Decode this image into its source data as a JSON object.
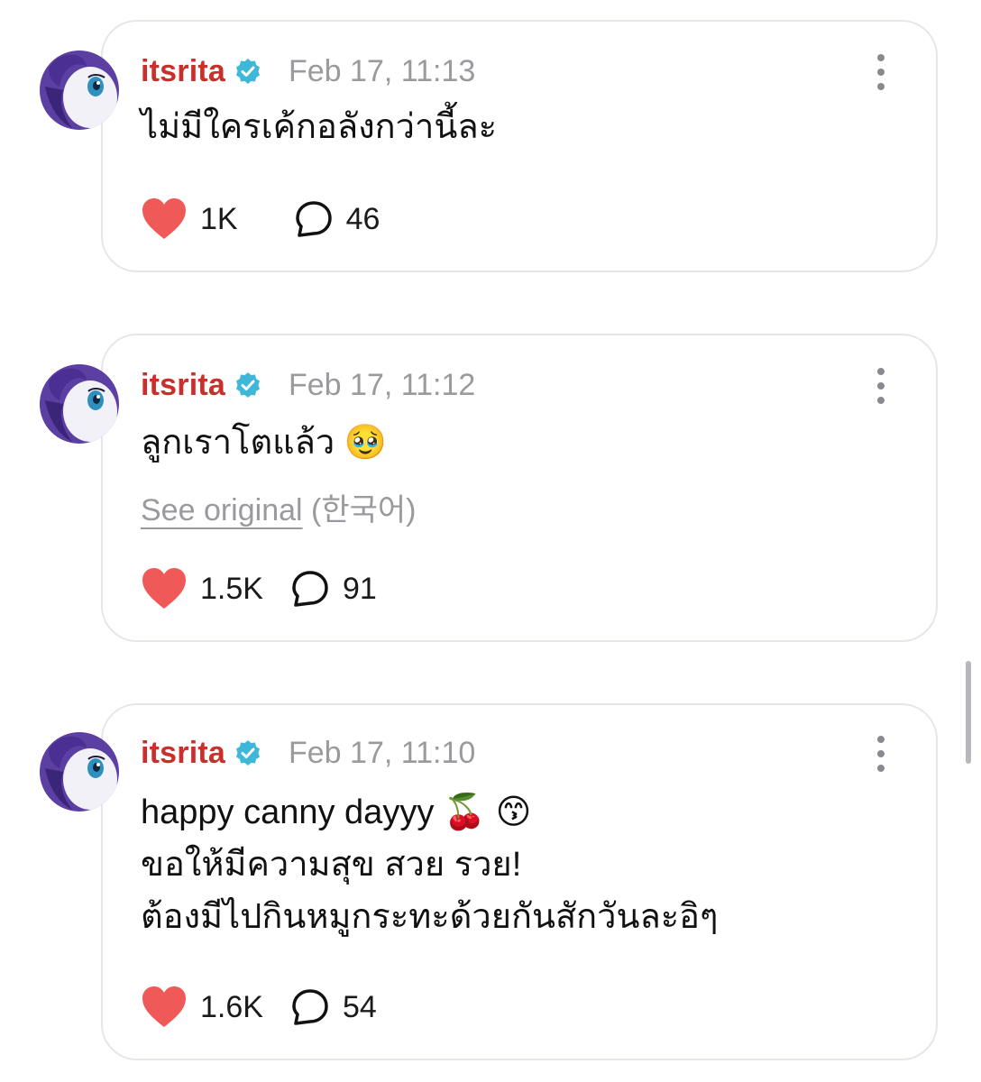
{
  "posts": [
    {
      "username": "itsrita",
      "timestamp": "Feb 17, 11:13",
      "text": "ไม่มีใครเค้กอลังกว่านี้ละ",
      "likes": "1K",
      "comments": "46"
    },
    {
      "username": "itsrita",
      "timestamp": "Feb 17, 11:12",
      "text": "ลูกเราโตแล้ว 🥹",
      "see_original_link": "See original",
      "see_original_lang": " (한국어)",
      "likes": "1.5K",
      "comments": "91"
    },
    {
      "username": "itsrita",
      "timestamp": "Feb 17, 11:10",
      "text": "happy canny dayyy 🍒 😙\nขอให้มีความสุข สวย รวย!\nต้องมีไปกินหมูกระทะด้วยกันสักวันละอิๆ",
      "likes": "1.6K",
      "comments": "54"
    }
  ],
  "colors": {
    "username": "#c92f2b",
    "heart": "#ef5a58",
    "verified": "#3fb7d8",
    "muted": "#9a9a9e"
  },
  "icons": [
    "verified-badge-icon",
    "more-options-icon",
    "heart-icon",
    "comment-icon"
  ]
}
